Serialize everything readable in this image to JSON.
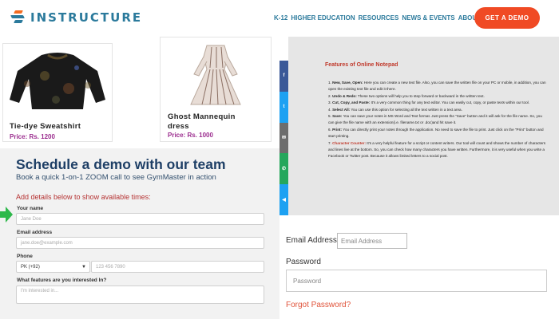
{
  "header": {
    "brand": "INSTRUCTURE",
    "nav": [
      "K-12",
      "HIGHER EDUCATION",
      "RESOURCES",
      "NEWS & EVENTS",
      "ABOUT US"
    ],
    "cta": "GET A DEMO"
  },
  "products": [
    {
      "name": "Tie-dye Sweatshirt",
      "price": "Price: Rs. 1200"
    },
    {
      "name": "Ghost Mannequin dress",
      "price": "Price: Rs. 1000"
    }
  ],
  "schedule": {
    "title": "Schedule a demo with our team",
    "subtitle": "Book a quick 1-on-1 ZOOM call to see GymMaster in action",
    "note": "Add details below to show available times:",
    "name_label": "Your name",
    "name_placeholder": "Jane Doe",
    "email_label": "Email address",
    "email_placeholder": "jane.doe@example.com",
    "phone_label": "Phone",
    "phone_country": "PK (+92)",
    "phone_placeholder": "123 456 7890",
    "features_label": "What features are you interested In?",
    "features_placeholder": "I'm interested in..."
  },
  "notepad": {
    "title": "Features of Online Notepad",
    "items": [
      {
        "head": "New, Save, Open:",
        "text": " Here you can create a new text file. Also, you can save the written file on your PC or mobile, in addition, you can open the existing text file and edit it there."
      },
      {
        "head": "Undo & Redo:",
        "text": " These two options will help you to step forward or backward in the written text."
      },
      {
        "head": "Cut, Copy, and Paste:",
        "text": " It's a very common thing for any text editor. You can easily cut, copy, or paste texts within our tool."
      },
      {
        "head": "Select All:",
        "text": " You can use this option for selecting all the text written in a text area."
      },
      {
        "head": "Save:",
        "text": " You can save your notes in MS Word and Text format. Just press the \"Save\" button and it will ask for the file name. So, you can give the file name with an extension(i.e. filename.txt or .doc)and hit save it."
      },
      {
        "head": "Print:",
        "text": " You can directly print your notes through the application. No need to save the file to print. Just click on the \"Print\" button and start printing."
      },
      {
        "head": "Character Counter:",
        "text": " It's a very helpful feature for a script or content writers. Our tool will count and shows the number of characters and lines live at the bottom. So, you can check how many characters you have written. Furthermore, it is very useful when you write a Facebook or Twitter post. Because it allows limited letters to a social post."
      }
    ]
  },
  "login": {
    "email_label": "Email Address",
    "email_placeholder": "Email Address",
    "password_label": "Password",
    "password_placeholder": "Password",
    "forgot": "Forgot Password?"
  },
  "colors": {
    "brand": "#2b7a9c",
    "cta": "#f04a24",
    "title": "#1e3f66",
    "price": "#9b2c8e",
    "share": [
      "#3b5998",
      "#1da1f2",
      "#6d6d6d",
      "#25a75c",
      "#1da1f2"
    ]
  },
  "share_icons": [
    "facebook-icon",
    "twitter-icon",
    "email-icon",
    "whatsapp-icon",
    "share-icon"
  ]
}
